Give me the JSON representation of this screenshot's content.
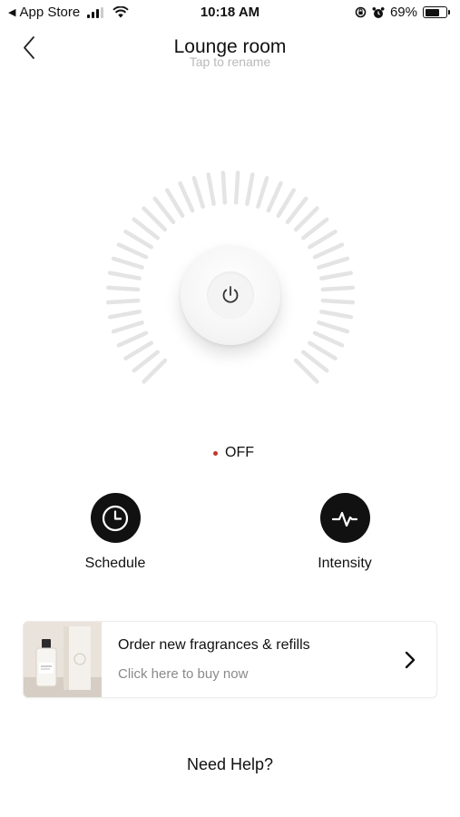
{
  "status_bar": {
    "back_app": "App Store",
    "time": "10:18 AM",
    "battery_percent": "69%",
    "battery_level": 0.69
  },
  "header": {
    "title": "Lounge room",
    "subtitle": "Tap to rename"
  },
  "dial": {
    "power_icon": "power-icon",
    "state_color": "#c0392b"
  },
  "status": {
    "text": "OFF"
  },
  "actions": [
    {
      "label": "Schedule",
      "icon": "clock-icon"
    },
    {
      "label": "Intensity",
      "icon": "pulse-icon"
    }
  ],
  "order_card": {
    "title": "Order new fragrances & refills",
    "subtitle": "Click here to buy now"
  },
  "help": {
    "label": "Need Help?"
  }
}
